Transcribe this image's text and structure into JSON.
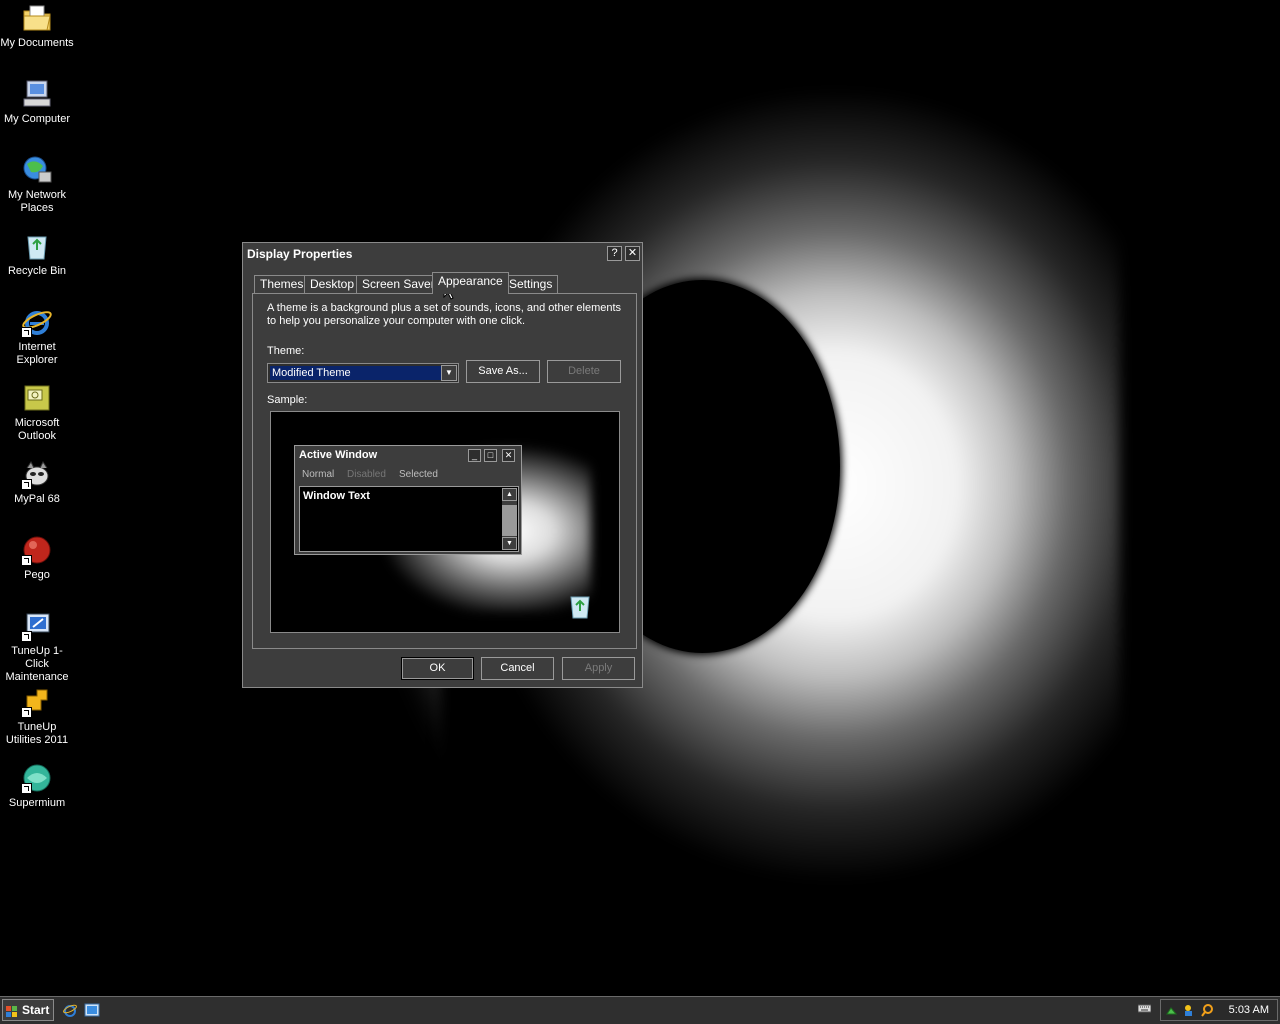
{
  "desktop": {
    "icons": [
      {
        "label": "My Documents",
        "icon": "folder-documents-icon"
      },
      {
        "label": "My Computer",
        "icon": "computer-icon"
      },
      {
        "label": "My Network Places",
        "icon": "network-icon"
      },
      {
        "label": "Recycle Bin",
        "icon": "recycle-bin-icon"
      },
      {
        "label": "Internet Explorer",
        "icon": "internet-explorer-icon"
      },
      {
        "label": "Microsoft Outlook",
        "icon": "outlook-icon"
      },
      {
        "label": "MyPal 68",
        "icon": "mypal-icon"
      },
      {
        "label": "Pego",
        "icon": "pego-icon"
      },
      {
        "label": "TuneUp 1-Click Maintenance",
        "icon": "tuneup-maintenance-icon"
      },
      {
        "label": "TuneUp Utilities 2011",
        "icon": "tuneup-utilities-icon"
      },
      {
        "label": "Supermium",
        "icon": "supermium-icon"
      }
    ]
  },
  "dialog": {
    "title": "Display Properties",
    "help_glyph": "?",
    "close_glyph": "✕",
    "tabs": [
      {
        "label": "Themes"
      },
      {
        "label": "Desktop"
      },
      {
        "label": "Screen Saver"
      },
      {
        "label": "Appearance"
      },
      {
        "label": "Settings"
      }
    ],
    "description": "A theme is a background plus a set of sounds, icons, and other elements to help you personalize your computer with one click.",
    "theme_label": "Theme:",
    "theme_value": "Modified Theme",
    "save_as_label": "Save As...",
    "delete_label": "Delete",
    "sample_label": "Sample:",
    "sample": {
      "window_title": "Active Window",
      "menu": [
        "Normal",
        "Disabled",
        "Selected"
      ],
      "window_text": "Window Text"
    },
    "ok_label": "OK",
    "cancel_label": "Cancel",
    "apply_label": "Apply"
  },
  "taskbar": {
    "start_label": "Start",
    "clock": "5:03 AM",
    "quick_launch": [
      "internet-explorer-icon",
      "show-desktop-icon"
    ],
    "tray_icons": [
      "keyboard-icon",
      "network-tray-icon",
      "users-tray-icon",
      "search-tray-icon"
    ]
  },
  "colors": {
    "dialog_bg": "#3d3d3d",
    "selection": "#0a246a",
    "taskbar_bg": "#2f2f2f"
  }
}
